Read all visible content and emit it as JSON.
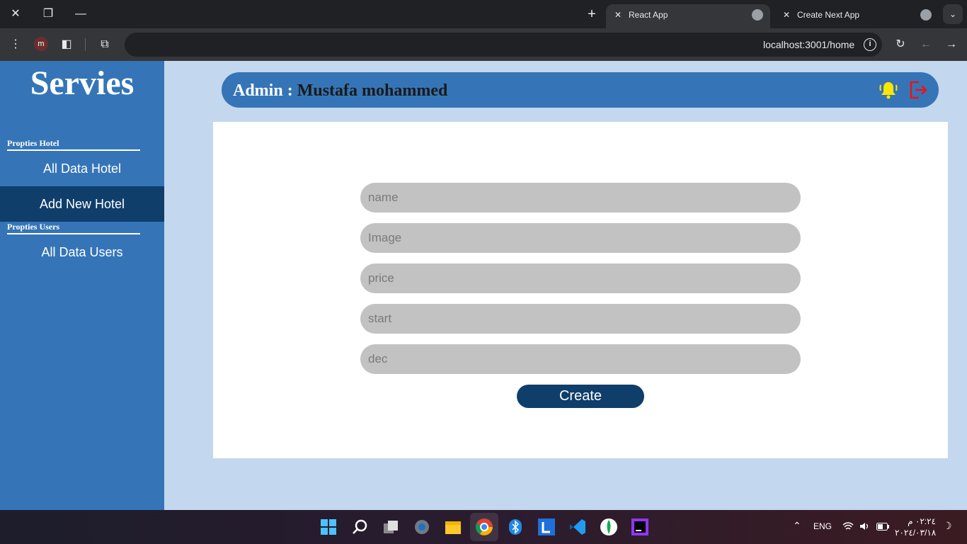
{
  "browser": {
    "tabs": [
      {
        "title": "React App",
        "active": true
      },
      {
        "title": "Create Next App",
        "active": false
      }
    ],
    "url": "localhost:3001/home",
    "profile_initial": "m"
  },
  "sidebar": {
    "brand": "Servies",
    "sections": [
      {
        "label": "Propties Hotel",
        "items": [
          {
            "label": "All Data Hotel",
            "active": false
          },
          {
            "label": "Add New Hotel",
            "active": true
          }
        ]
      },
      {
        "label": "Propties Users",
        "items": [
          {
            "label": "All Data Users",
            "active": false
          }
        ]
      }
    ]
  },
  "header": {
    "admin_prefix": "Admin : ",
    "admin_name": "Mustafa mohammed"
  },
  "form": {
    "fields": [
      {
        "placeholder": "name"
      },
      {
        "placeholder": "Image"
      },
      {
        "placeholder": "price"
      },
      {
        "placeholder": "start"
      },
      {
        "placeholder": "dec"
      }
    ],
    "submit_label": "Create"
  },
  "taskbar": {
    "language": "ENG",
    "time": "٠٢:٢٤ م",
    "date": "٢٠٢٤/٠٣/١٨"
  },
  "colors": {
    "sidebar": "#3575b7",
    "active_nav": "#0f3e6b",
    "background": "#c3d7ee",
    "bell": "#ffe600",
    "logout": "#e8141b"
  }
}
